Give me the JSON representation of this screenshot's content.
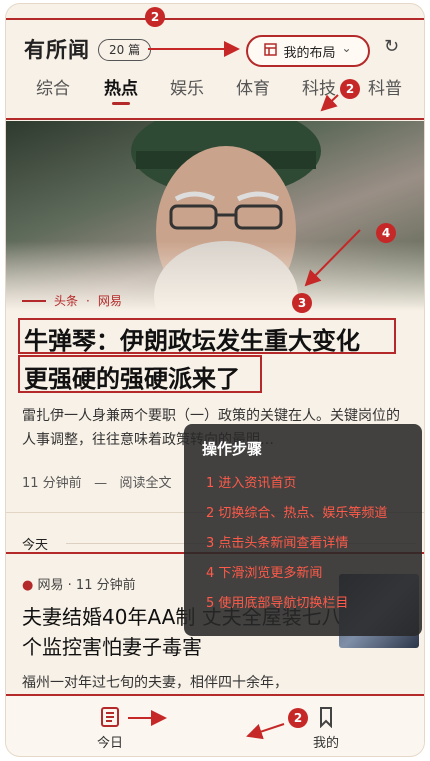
{
  "header": {
    "app_title": "有所闻",
    "count_badge": "20 篇",
    "layout_label": "我的布局",
    "layout_chevron": "⌄",
    "refresh_icon": "↻",
    "tabs": [
      "综合",
      "热点",
      "娱乐",
      "体育",
      "科技",
      "科普"
    ],
    "active_tab": "热点"
  },
  "lead_story": {
    "meta_source": "头条",
    "meta_sep": "·",
    "meta_outlet": "网易",
    "headline_line1": "牛弹琴：伊朗政坛发生重大变化",
    "headline_line2": "更强硬的强硬派来了",
    "summary": "雷扎伊一人身兼两个要职（一）政策的关键在人。关键岗位的人事调整，往往意味着政策转向的最明…",
    "time": "11  分钟前",
    "sep": "—",
    "read_full": "阅读全文"
  },
  "feed": {
    "today_label": "今天",
    "story": {
      "source": "网易",
      "sep": "·",
      "time": "11  分钟前",
      "title": "夫妻结婚40年AA制 丈夫全屋装七八个监控害怕妻子毒害",
      "summary": "福州一对年过七旬的夫妻，相伴四十余年，"
    }
  },
  "bottom_nav": {
    "today_label": "今日",
    "mine_label": "我的"
  },
  "overlay": {
    "title": "操作步骤",
    "steps": [
      "1  进入资讯首页",
      "2  切换综合、热点、娱乐等频道",
      "3  点击头条新闻查看详情",
      "4  下滑浏览更多新闻",
      "5  使用底部导航切换栏目"
    ]
  },
  "markers": {
    "top": "2",
    "tabs": "2",
    "headline": "3",
    "hero": "4",
    "nav": "2"
  },
  "colors": {
    "accent": "#b42a2a",
    "background": "#f8f1e7",
    "overlay_step": "#ff5a4a"
  }
}
